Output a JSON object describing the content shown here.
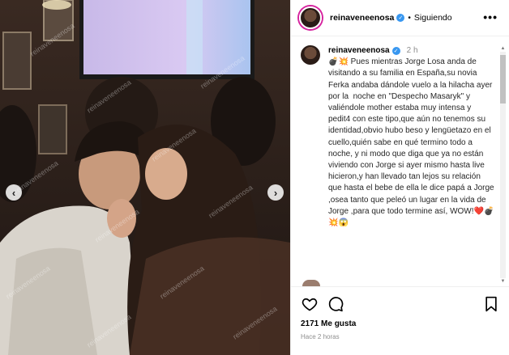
{
  "colors": {
    "follow_ring": "#d6249f",
    "verified": "#3897f0",
    "heart_emoji": "#c0143c"
  },
  "media": {
    "watermark": "reinaveneenosa",
    "prev_icon": "chevron-left-icon",
    "next_icon": "chevron-right-icon",
    "prev_glyph": "‹",
    "next_glyph": "›"
  },
  "header": {
    "username": "reinaveneenosa",
    "separator": "•",
    "follow_status": "Siguiendo",
    "more_glyph": "•••"
  },
  "caption": {
    "username": "reinaveneenosa",
    "time": "2 h",
    "text": "💣💥 Pues mientras Jorge Losa anda de visitando a su familia en España,su novia Ferka andaba dándole vuelo a la hilacha ayer por la  noche en \"Despecho Masaryk\" y valiéndole mother estaba muy intensa y pedit4 con este tipo,que aún no tenemos su identidad,obvio hubo beso y lengüetazo en el cuello,quién sabe en qué termino todo a noche, y ni modo que diga que ya no están viviendo con Jorge si ayer mismo hasta live hicieron,y han llevado tan lejos su relación que hasta el bebe de ella le dice papá a Jorge ,osea tanto que peleó un lugar en la vida de Jorge ,para que todo termine así, WOW!❤️💣💥😱"
  },
  "actions": {
    "like_icon": "heart-icon",
    "comment_icon": "comment-icon",
    "bookmark_icon": "bookmark-icon"
  },
  "likes": "2171 Me gusta",
  "posted_ago": "Hace 2 horas"
}
